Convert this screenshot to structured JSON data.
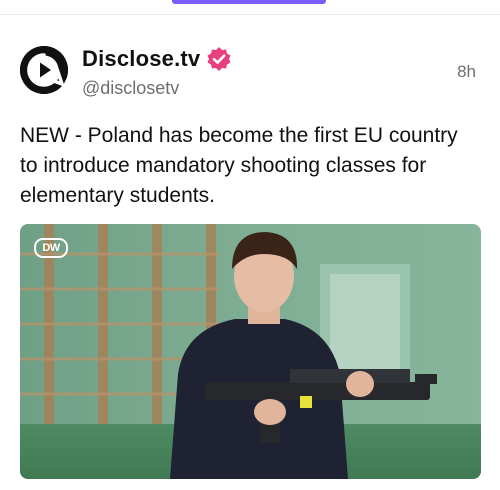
{
  "post": {
    "display_name": "Disclose.tv",
    "handle": "@disclosetv",
    "time": "8h",
    "text": "NEW - Poland has become the first EU country to introduce mandatory shooting classes for elementary students.",
    "verified_icon": "verified-badge-icon",
    "avatar_icon": "play-logo-icon"
  },
  "media": {
    "watermark": "DW"
  },
  "colors": {
    "accent": "#7b5cff",
    "verified": "#e8407f",
    "handle_gray": "#6b6f73"
  }
}
